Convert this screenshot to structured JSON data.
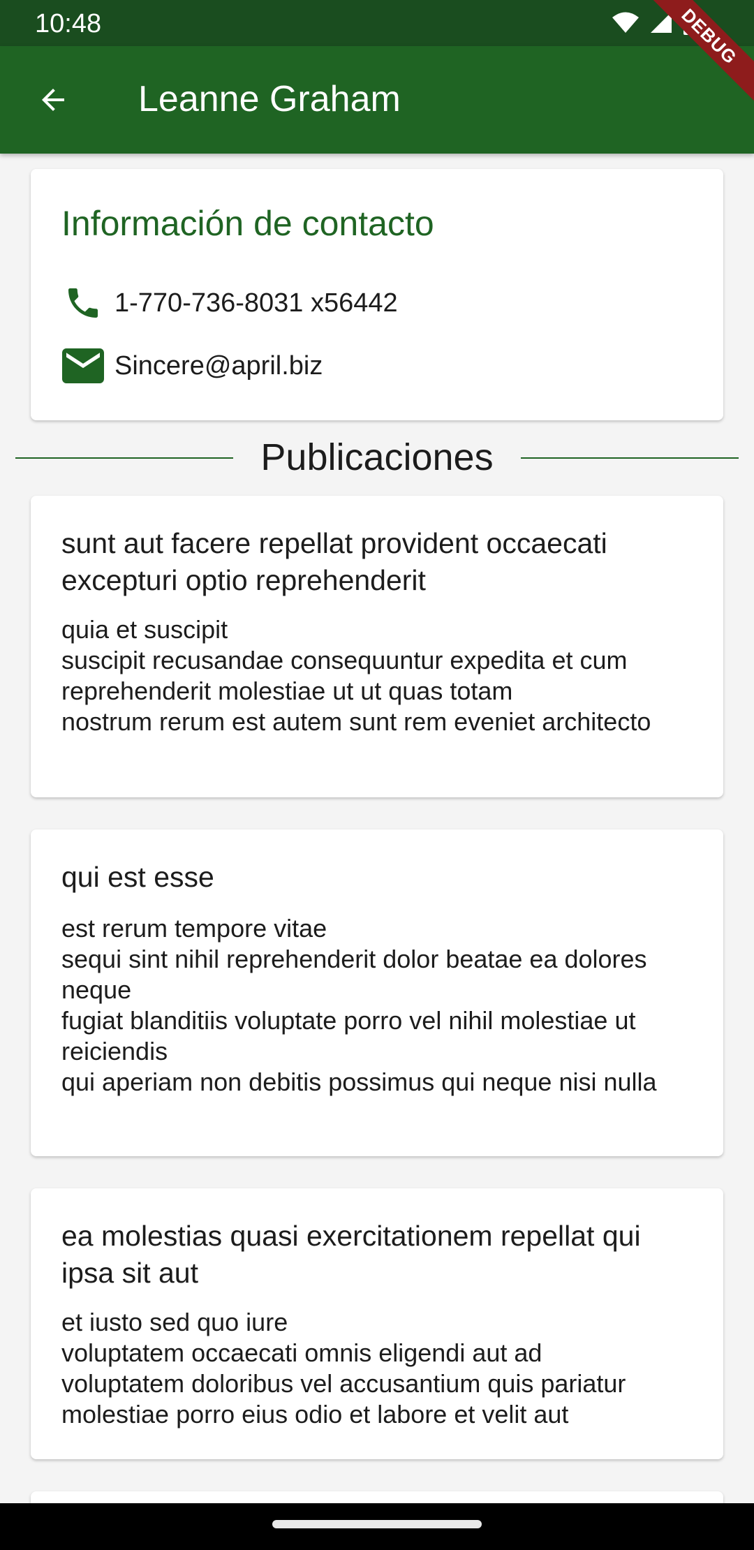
{
  "status_bar": {
    "time": "10:48",
    "icons": [
      "wifi-icon",
      "cellular-signal-icon",
      "battery-icon"
    ]
  },
  "app_bar": {
    "title": "Leanne Graham",
    "back_icon": "arrow-back-icon",
    "color": "#1f6423"
  },
  "debug_banner": "DEBUG",
  "contact": {
    "title": "Información de contacto",
    "phone": "1-770-736-8031 x56442",
    "email": "Sincere@april.biz"
  },
  "section": {
    "title": "Publicaciones"
  },
  "posts": [
    {
      "title": "sunt aut facere repellat provident occaecati excepturi optio reprehenderit",
      "body": "quia et suscipit\nsuscipit recusandae consequuntur expedita et cum reprehenderit molestiae ut ut quas totam\nnostrum rerum est autem sunt rem eveniet architecto"
    },
    {
      "title": "qui est esse",
      "body": "est rerum tempore vitae\nsequi sint nihil reprehenderit dolor beatae ea dolores neque\nfugiat blanditiis voluptate porro vel nihil molestiae ut reiciendis\nqui aperiam non debitis possimus qui neque nisi nulla"
    },
    {
      "title": "ea molestias quasi exercitationem repellat qui ipsa sit aut",
      "body": "et iusto sed quo iure\nvoluptatem occaecati omnis eligendi aut ad\nvoluptatem doloribus vel accusantium quis pariatur\nmolestiae porro eius odio et labore et velit aut"
    }
  ],
  "colors": {
    "primary": "#1f6423",
    "status_bar": "#1a4d1f",
    "debug": "#8e1c1c",
    "background": "#f4f4f4"
  }
}
